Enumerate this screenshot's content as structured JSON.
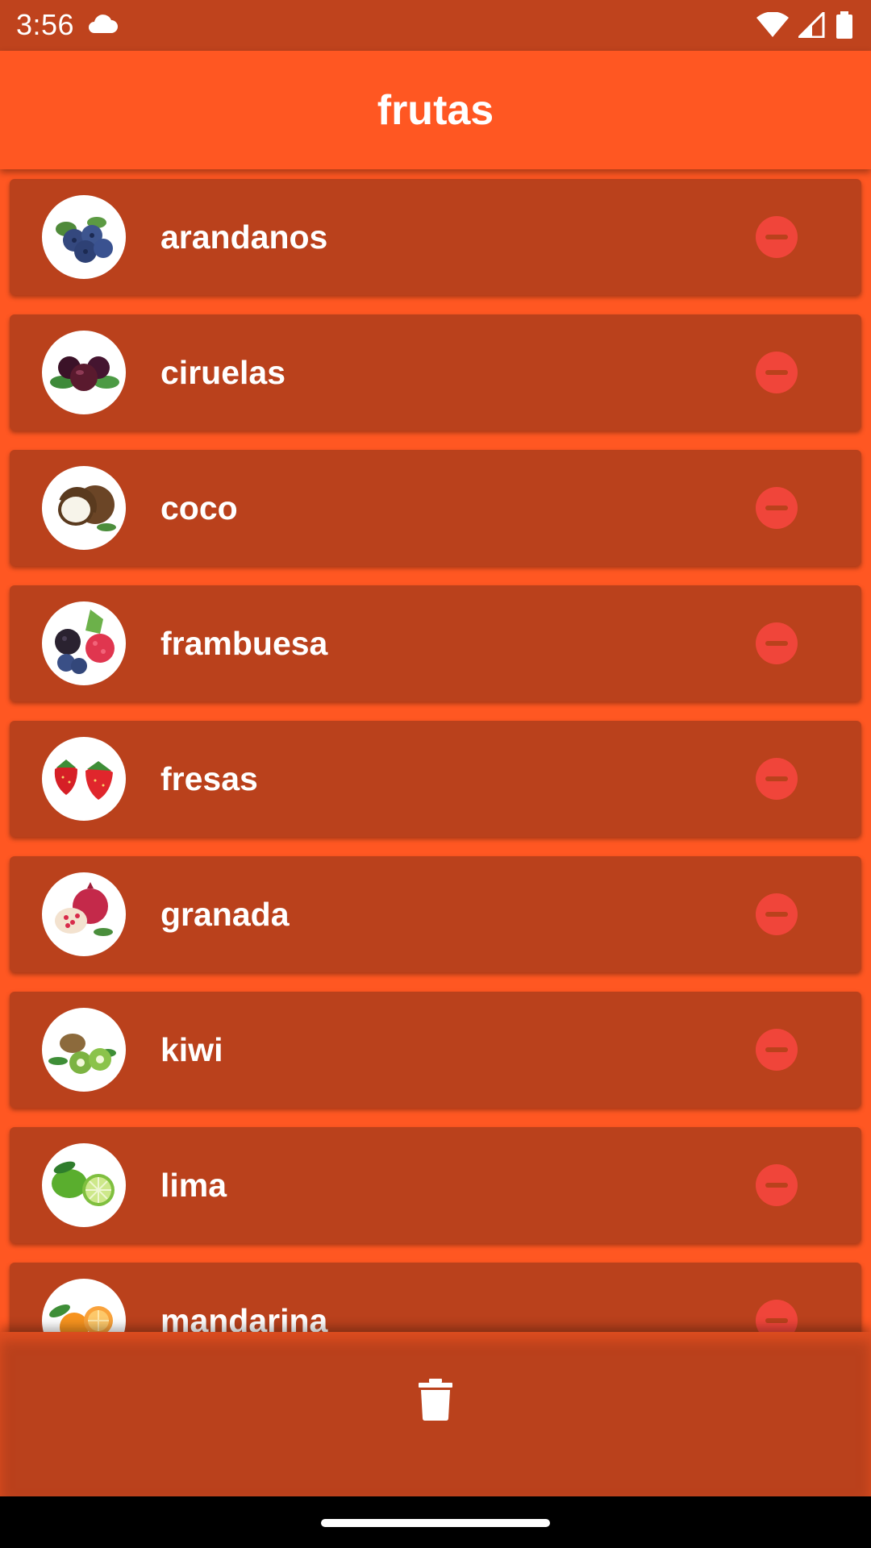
{
  "status_bar": {
    "time": "3:56",
    "icons": [
      "cloud-icon",
      "wifi-icon",
      "signal-icon",
      "battery-icon"
    ]
  },
  "app_bar": {
    "title": "frutas"
  },
  "fruits": [
    {
      "name": "arandanos",
      "icon": "blueberry-icon"
    },
    {
      "name": "ciruelas",
      "icon": "plum-icon"
    },
    {
      "name": "coco",
      "icon": "coconut-icon"
    },
    {
      "name": "frambuesa",
      "icon": "raspberry-icon"
    },
    {
      "name": "fresas",
      "icon": "strawberry-icon"
    },
    {
      "name": "granada",
      "icon": "pomegranate-icon"
    },
    {
      "name": "kiwi",
      "icon": "kiwi-icon"
    },
    {
      "name": "lima",
      "icon": "lime-icon"
    },
    {
      "name": "mandarina",
      "icon": "tangerine-icon"
    }
  ],
  "bottom_bar": {
    "action_icon": "trash-icon"
  },
  "colors": {
    "primary": "#FF5722",
    "card": "#BA411C",
    "status_bar": "#BF431D",
    "remove": "#F0453A"
  }
}
